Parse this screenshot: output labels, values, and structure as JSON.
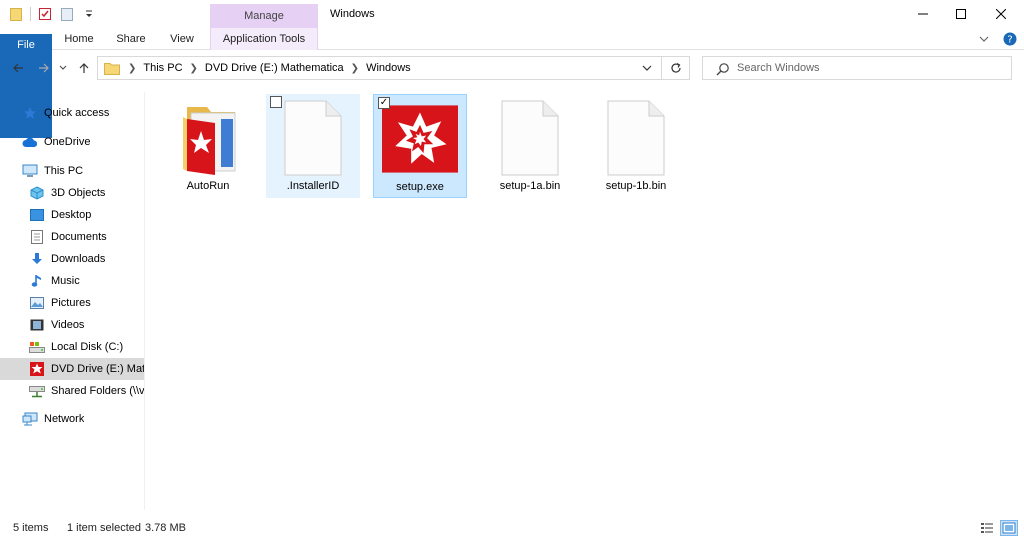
{
  "titlebar": {
    "title": "Windows",
    "context_group": "Manage"
  },
  "ribbon": {
    "tabs": [
      {
        "label": "File"
      },
      {
        "label": "Home"
      },
      {
        "label": "Share"
      },
      {
        "label": "View"
      },
      {
        "label": "Application Tools"
      }
    ]
  },
  "address": {
    "crumbs": [
      "This PC",
      "DVD Drive (E:) Mathematica",
      "Windows"
    ]
  },
  "search": {
    "placeholder": "Search Windows"
  },
  "sidebar": {
    "items": [
      {
        "label": "Quick access",
        "icon": "star-icon"
      },
      {
        "label": "OneDrive",
        "icon": "cloud-icon"
      },
      {
        "label": "This PC",
        "icon": "computer-icon"
      },
      {
        "label": "3D Objects",
        "icon": "cube-icon"
      },
      {
        "label": "Desktop",
        "icon": "desktop-icon"
      },
      {
        "label": "Documents",
        "icon": "document-icon"
      },
      {
        "label": "Downloads",
        "icon": "download-icon"
      },
      {
        "label": "Music",
        "icon": "music-icon"
      },
      {
        "label": "Pictures",
        "icon": "picture-icon"
      },
      {
        "label": "Videos",
        "icon": "video-icon"
      },
      {
        "label": "Local Disk (C:)",
        "icon": "disk-icon"
      },
      {
        "label": "DVD Drive (E:) Mathematica",
        "icon": "mathematica-icon"
      },
      {
        "label": "Shared Folders (\\\\vmware-host)",
        "icon": "network-drive-icon"
      },
      {
        "label": "Network",
        "icon": "network-icon"
      }
    ]
  },
  "files": [
    {
      "name": "AutoRun",
      "icon": "autorun-folder-icon"
    },
    {
      "name": ".InstallerID",
      "icon": "blank-file-icon"
    },
    {
      "name": "setup.exe",
      "icon": "mathematica-icon"
    },
    {
      "name": "setup-1a.bin",
      "icon": "blank-file-icon"
    },
    {
      "name": "setup-1b.bin",
      "icon": "blank-file-icon"
    }
  ],
  "status": {
    "count": "5 items",
    "selection": "1 item selected",
    "size": "3.78 MB"
  },
  "colors": {
    "file_tab": "#1a68b8",
    "manage_tab": "#e6d1f5",
    "selection": "#cce8ff",
    "mathematica_red": "#d7141a"
  }
}
